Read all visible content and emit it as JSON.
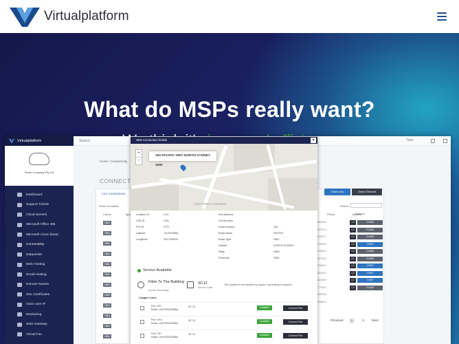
{
  "nav": {
    "brand": "Virtualplatform",
    "menu_icon": "hamburger-menu-icon",
    "logo_colors": [
      "#1a4a8e",
      "#5b9fe0"
    ]
  },
  "hero": {
    "title": "What do MSPs really want?",
    "subtitle_prefix": "We think it's ",
    "subtitle_accent": "improved efficiency",
    "accent_color": "#3fa62a"
  },
  "app": {
    "sidebar_brand": "Virtualplatform",
    "company": "Demo Company Pty Ltd",
    "search_label": "Search",
    "user_label": "Tyler",
    "sidebar_items": [
      "Dashboard",
      "Support Tickets",
      "Cloud Servers",
      "Microsoft Office 365",
      "Microsoft Azure (beta)",
      "Connectivity",
      "Datacenter",
      "Web Hosting",
      "Email Hosting",
      "Domain Names",
      "SSL Certificates",
      "Voice over IP",
      "Monitoring",
      "SMS Gateway",
      "Virtual Fax"
    ],
    "active_sidebar_index": 5,
    "breadcrumb": "Home / Connectivity",
    "connectivity_title": "CONNECTIVITY",
    "live_title": "Live Connections",
    "show_label": "Show 10 entries",
    "table_headers": [
      "Carrier",
      "Type",
      "Phone",
      "Options"
    ],
    "row_badges": [
      "NBN",
      "NBN",
      "NBN",
      "NBN",
      "NBN",
      "NBN",
      "NBN",
      "NBN",
      "NBN",
      "NBN",
      "NBN",
      "NBN"
    ],
    "order_new": "Order new",
    "order_ethernet": "Order Ethernet",
    "search_box_label": "Search:",
    "options_label": "Options",
    "phones": [
      "0396584848",
      "0756323214",
      "0356325471",
      "0212340002",
      "0212345678",
      "0356327654",
      "0398760001",
      "0356320087",
      "0756324560",
      "0487770001",
      "0356987654",
      "0396588876"
    ],
    "option_rows": [
      {
        "l": "L3",
        "r": "214AB",
        "blue": false
      },
      {
        "l": "L3",
        "r": "214AB",
        "blue": false
      },
      {
        "l": "L3",
        "r": "214AB",
        "blue": false
      },
      {
        "l": "L3",
        "r": "CONT",
        "blue": true
      },
      {
        "l": "L3",
        "r": "214AB",
        "blue": false
      },
      {
        "l": "L3",
        "r": "214AB",
        "blue": false
      },
      {
        "l": "L3",
        "r": "CONT",
        "blue": true
      },
      {
        "l": "L3",
        "r": "CONT",
        "blue": true
      },
      {
        "l": "L3",
        "r": "CONT",
        "blue": true
      },
      {
        "l": "L3",
        "r": "214AB",
        "blue": false
      }
    ],
    "pager": {
      "previous": "Previous",
      "pages": [
        "1",
        "2"
      ],
      "next": "Next"
    }
  },
  "modal": {
    "title": "NBN Connection Details",
    "map_popup": "150 PACIFIC HWY NORTH SYDNEY 2060",
    "map_label": "VICTORIA CROSS",
    "zoom_in": "+",
    "zoom_out": "−",
    "details_left": [
      [
        "Location ID",
        "LOC"
      ],
      [
        "CSA ID",
        "CSA"
      ],
      [
        "POI ID",
        "2VTL"
      ],
      [
        "Latitude",
        "-33.8378683"
      ],
      [
        "Longitude",
        "151.2056111"
      ]
    ],
    "details_right": [
      [
        "Sub Address",
        ""
      ],
      [
        "Unit Number",
        ""
      ],
      [
        "Road Number",
        "150"
      ],
      [
        "Road Name",
        "PACIFIC"
      ],
      [
        "Road Type",
        "HWY"
      ],
      [
        "Suburb",
        "NORTH SYDNEY"
      ],
      [
        "State",
        "NSW"
      ],
      [
        "Postcode",
        "2060"
      ]
    ],
    "service_available": "Service Available",
    "fibre_title": "Fibre To The Building",
    "fibre_sub": "Access Technology",
    "sc_code": "SC12",
    "sc_sub": "Service Class",
    "sc_note": "The location is serviceable by copper, connecting is required",
    "copper_head": "Copper Lines",
    "copper_lines": [
      {
        "pair": "Port: CPI",
        "rates": "Rates: 100/75/40/20Mbs",
        "sc": "SC 12",
        "status": "Available",
        "action": "Connect Port"
      },
      {
        "pair": "Port: CP4",
        "rates": "Rates: 100/75/40/20Mbs",
        "sc": "SC 12",
        "status": "Available",
        "action": "Connect Port"
      },
      {
        "pair": "Port: CPI",
        "rates": "Rates: 100/75/40/20Mbs",
        "sc": "SC 12",
        "status": "Available",
        "action": "Connect Port"
      }
    ]
  }
}
